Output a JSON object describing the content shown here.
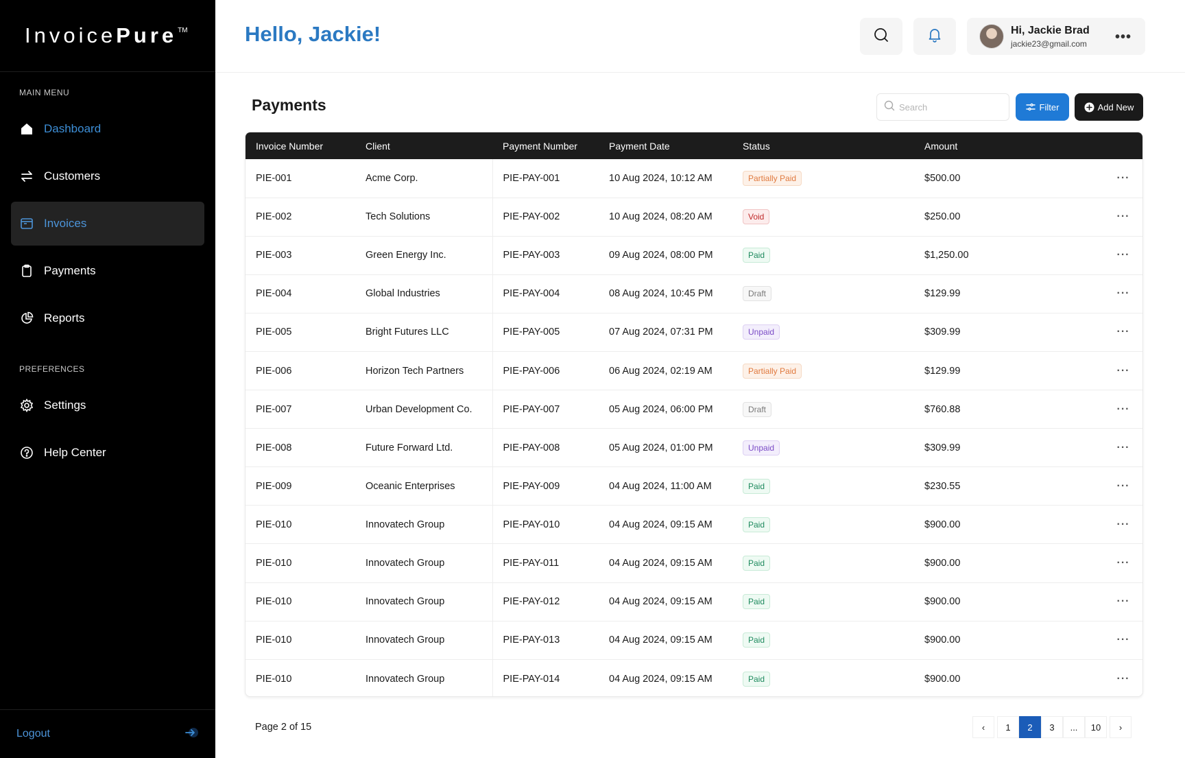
{
  "brand": {
    "light": "Invoice",
    "bold": "Pure",
    "tm": "TM"
  },
  "sidebar": {
    "main_menu_label": "MAIN MENU",
    "preferences_label": "PREFERENCES",
    "items": [
      {
        "label": "Dashboard",
        "icon": "home-icon"
      },
      {
        "label": "Customers",
        "icon": "swap-arrows-icon"
      },
      {
        "label": "Invoices",
        "icon": "folder-icon"
      },
      {
        "label": "Payments",
        "icon": "clipboard-icon"
      },
      {
        "label": "Reports",
        "icon": "pie-chart-icon"
      }
    ],
    "pref_items": [
      {
        "label": "Settings",
        "icon": "gear-icon"
      },
      {
        "label": "Help Center",
        "icon": "question-circle-icon"
      }
    ],
    "logout_label": "Logout"
  },
  "header": {
    "greeting": "Hello, Jackie!",
    "user_name": "Hi, Jackie Brad",
    "user_email": "jackie23@gmail.com"
  },
  "main": {
    "title": "Payments",
    "search_placeholder": "Search",
    "filter_label": "Filter",
    "add_label": "Add New"
  },
  "table": {
    "columns": [
      "Invoice Number",
      "Client",
      "Payment Number",
      "Payment Date",
      "Status",
      "Amount"
    ],
    "rows": [
      {
        "invoice": "PIE-001",
        "client": "Acme Corp.",
        "payment": "PIE-PAY-001",
        "date": "10 Aug 2024, 10:12 AM",
        "status": "Partially Paid",
        "status_type": "partial",
        "amount": "$500.00"
      },
      {
        "invoice": "PIE-002",
        "client": "Tech Solutions",
        "payment": "PIE-PAY-002",
        "date": "10 Aug 2024, 08:20 AM",
        "status": "Void",
        "status_type": "void",
        "amount": "$250.00"
      },
      {
        "invoice": "PIE-003",
        "client": "Green Energy Inc.",
        "payment": "PIE-PAY-003",
        "date": "09 Aug 2024, 08:00 PM",
        "status": "Paid",
        "status_type": "paid",
        "amount": "$1,250.00"
      },
      {
        "invoice": "PIE-004",
        "client": "Global Industries",
        "payment": "PIE-PAY-004",
        "date": "08 Aug 2024, 10:45 PM",
        "status": "Draft",
        "status_type": "draft",
        "amount": "$129.99"
      },
      {
        "invoice": "PIE-005",
        "client": "Bright Futures LLC",
        "payment": "PIE-PAY-005",
        "date": "07 Aug 2024, 07:31 PM",
        "status": "Unpaid",
        "status_type": "unpaid",
        "amount": "$309.99"
      },
      {
        "invoice": "PIE-006",
        "client": "Horizon Tech Partners",
        "payment": "PIE-PAY-006",
        "date": "06 Aug 2024, 02:19 AM",
        "status": "Partially Paid",
        "status_type": "partial",
        "amount": "$129.99"
      },
      {
        "invoice": "PIE-007",
        "client": "Urban Development Co.",
        "payment": "PIE-PAY-007",
        "date": "05 Aug 2024, 06:00 PM",
        "status": "Draft",
        "status_type": "draft",
        "amount": "$760.88"
      },
      {
        "invoice": "PIE-008",
        "client": "Future Forward Ltd.",
        "payment": "PIE-PAY-008",
        "date": "05 Aug 2024, 01:00 PM",
        "status": "Unpaid",
        "status_type": "unpaid",
        "amount": "$309.99"
      },
      {
        "invoice": "PIE-009",
        "client": "Oceanic Enterprises",
        "payment": "PIE-PAY-009",
        "date": "04 Aug 2024, 11:00 AM",
        "status": "Paid",
        "status_type": "paid",
        "amount": "$230.55"
      },
      {
        "invoice": "PIE-010",
        "client": "Innovatech Group",
        "payment": "PIE-PAY-010",
        "date": "04 Aug 2024, 09:15 AM",
        "status": "Paid",
        "status_type": "paid",
        "amount": "$900.00"
      },
      {
        "invoice": "PIE-010",
        "client": "Innovatech Group",
        "payment": "PIE-PAY-011",
        "date": "04 Aug 2024, 09:15 AM",
        "status": "Paid",
        "status_type": "paid",
        "amount": "$900.00"
      },
      {
        "invoice": "PIE-010",
        "client": "Innovatech Group",
        "payment": "PIE-PAY-012",
        "date": "04 Aug 2024, 09:15 AM",
        "status": "Paid",
        "status_type": "paid",
        "amount": "$900.00"
      },
      {
        "invoice": "PIE-010",
        "client": "Innovatech Group",
        "payment": "PIE-PAY-013",
        "date": "04 Aug 2024, 09:15 AM",
        "status": "Paid",
        "status_type": "paid",
        "amount": "$900.00"
      },
      {
        "invoice": "PIE-010",
        "client": "Innovatech Group",
        "payment": "PIE-PAY-014",
        "date": "04 Aug 2024, 09:15 AM",
        "status": "Paid",
        "status_type": "paid",
        "amount": "$900.00"
      }
    ]
  },
  "pagination": {
    "info": "Page 2 of 15",
    "pages": [
      "1",
      "2",
      "3",
      "...",
      "10"
    ],
    "current": "2",
    "prev": "‹",
    "next": "›"
  },
  "colors": {
    "accent": "#2b79c2",
    "sidebar_bg": "#000000",
    "filter_button": "#1f7ad6",
    "active_page": "#1b5cb8"
  }
}
